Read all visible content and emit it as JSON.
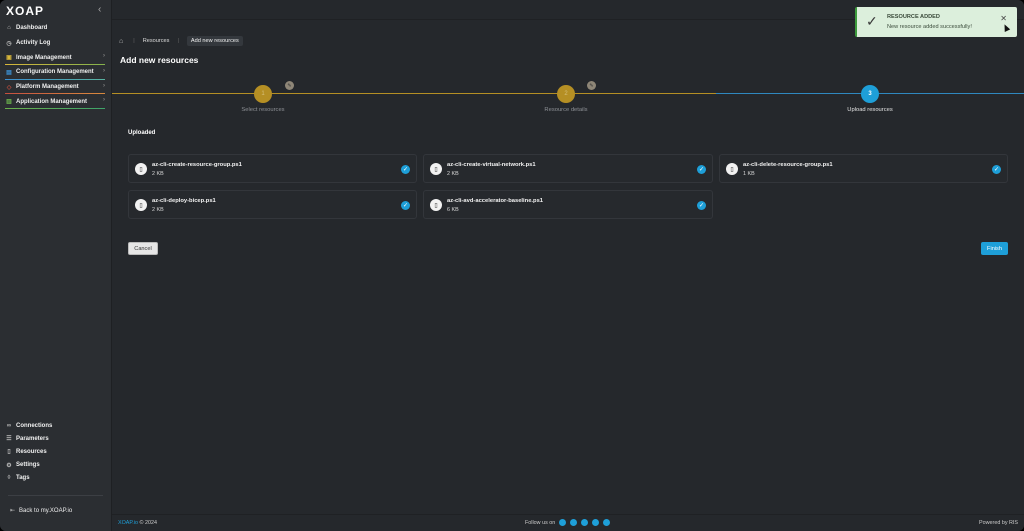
{
  "app": {
    "logo": "XOAP"
  },
  "sidebar": {
    "items": [
      {
        "label": "Dashboard",
        "icon": "home-icon",
        "chevron": false
      },
      {
        "label": "Activity Log",
        "icon": "clock-icon",
        "chevron": false
      },
      {
        "label": "Image Management",
        "icon": "image-icon",
        "chevron": true
      },
      {
        "label": "Configuration Management",
        "icon": "config-icon",
        "chevron": true
      },
      {
        "label": "Platform Management",
        "icon": "platform-icon",
        "chevron": true
      },
      {
        "label": "Application Management",
        "icon": "app-icon",
        "chevron": true
      }
    ],
    "bottom_items": [
      {
        "label": "Connections",
        "icon": "link-icon"
      },
      {
        "label": "Parameters",
        "icon": "list-icon"
      },
      {
        "label": "Resources",
        "icon": "file-icon"
      },
      {
        "label": "Settings",
        "icon": "gear-icon"
      },
      {
        "label": "Tags",
        "icon": "tag-icon"
      }
    ],
    "back_label": "Back to my.XOAP.io"
  },
  "breadcrumb": {
    "items": [
      "Resources",
      "Add new resources"
    ]
  },
  "page": {
    "title": "Add new resources",
    "section": "Uploaded"
  },
  "stepper": {
    "steps": [
      {
        "number": "1",
        "label": "Select resources",
        "state": "complete"
      },
      {
        "number": "2",
        "label": "Resource details",
        "state": "complete"
      },
      {
        "number": "3",
        "label": "Upload resources",
        "state": "active"
      }
    ]
  },
  "files": [
    {
      "name": "az-cli-create-resource-group.ps1",
      "size": "2 KB"
    },
    {
      "name": "az-cli-create-virtual-network.ps1",
      "size": "2 KB"
    },
    {
      "name": "az-cli-delete-resource-group.ps1",
      "size": "1 KB"
    },
    {
      "name": "az-cli-deploy-bicep.ps1",
      "size": "2 KB"
    },
    {
      "name": "az-cli-avd-accelerator-baseline.ps1",
      "size": "6 KB"
    }
  ],
  "actions": {
    "cancel": "Cancel",
    "finish": "Finish"
  },
  "footer": {
    "brand": "XOAP.io",
    "copyright": "© 2024",
    "follow": "Follow us on",
    "powered": "Powered by RIS"
  },
  "toast": {
    "title": "RESOURCE ADDED",
    "message": "New resource added successfully!"
  },
  "colors": {
    "accent": "#1e9fd8",
    "step_done": "#b58f24",
    "toast_bg": "#dcefdc"
  }
}
